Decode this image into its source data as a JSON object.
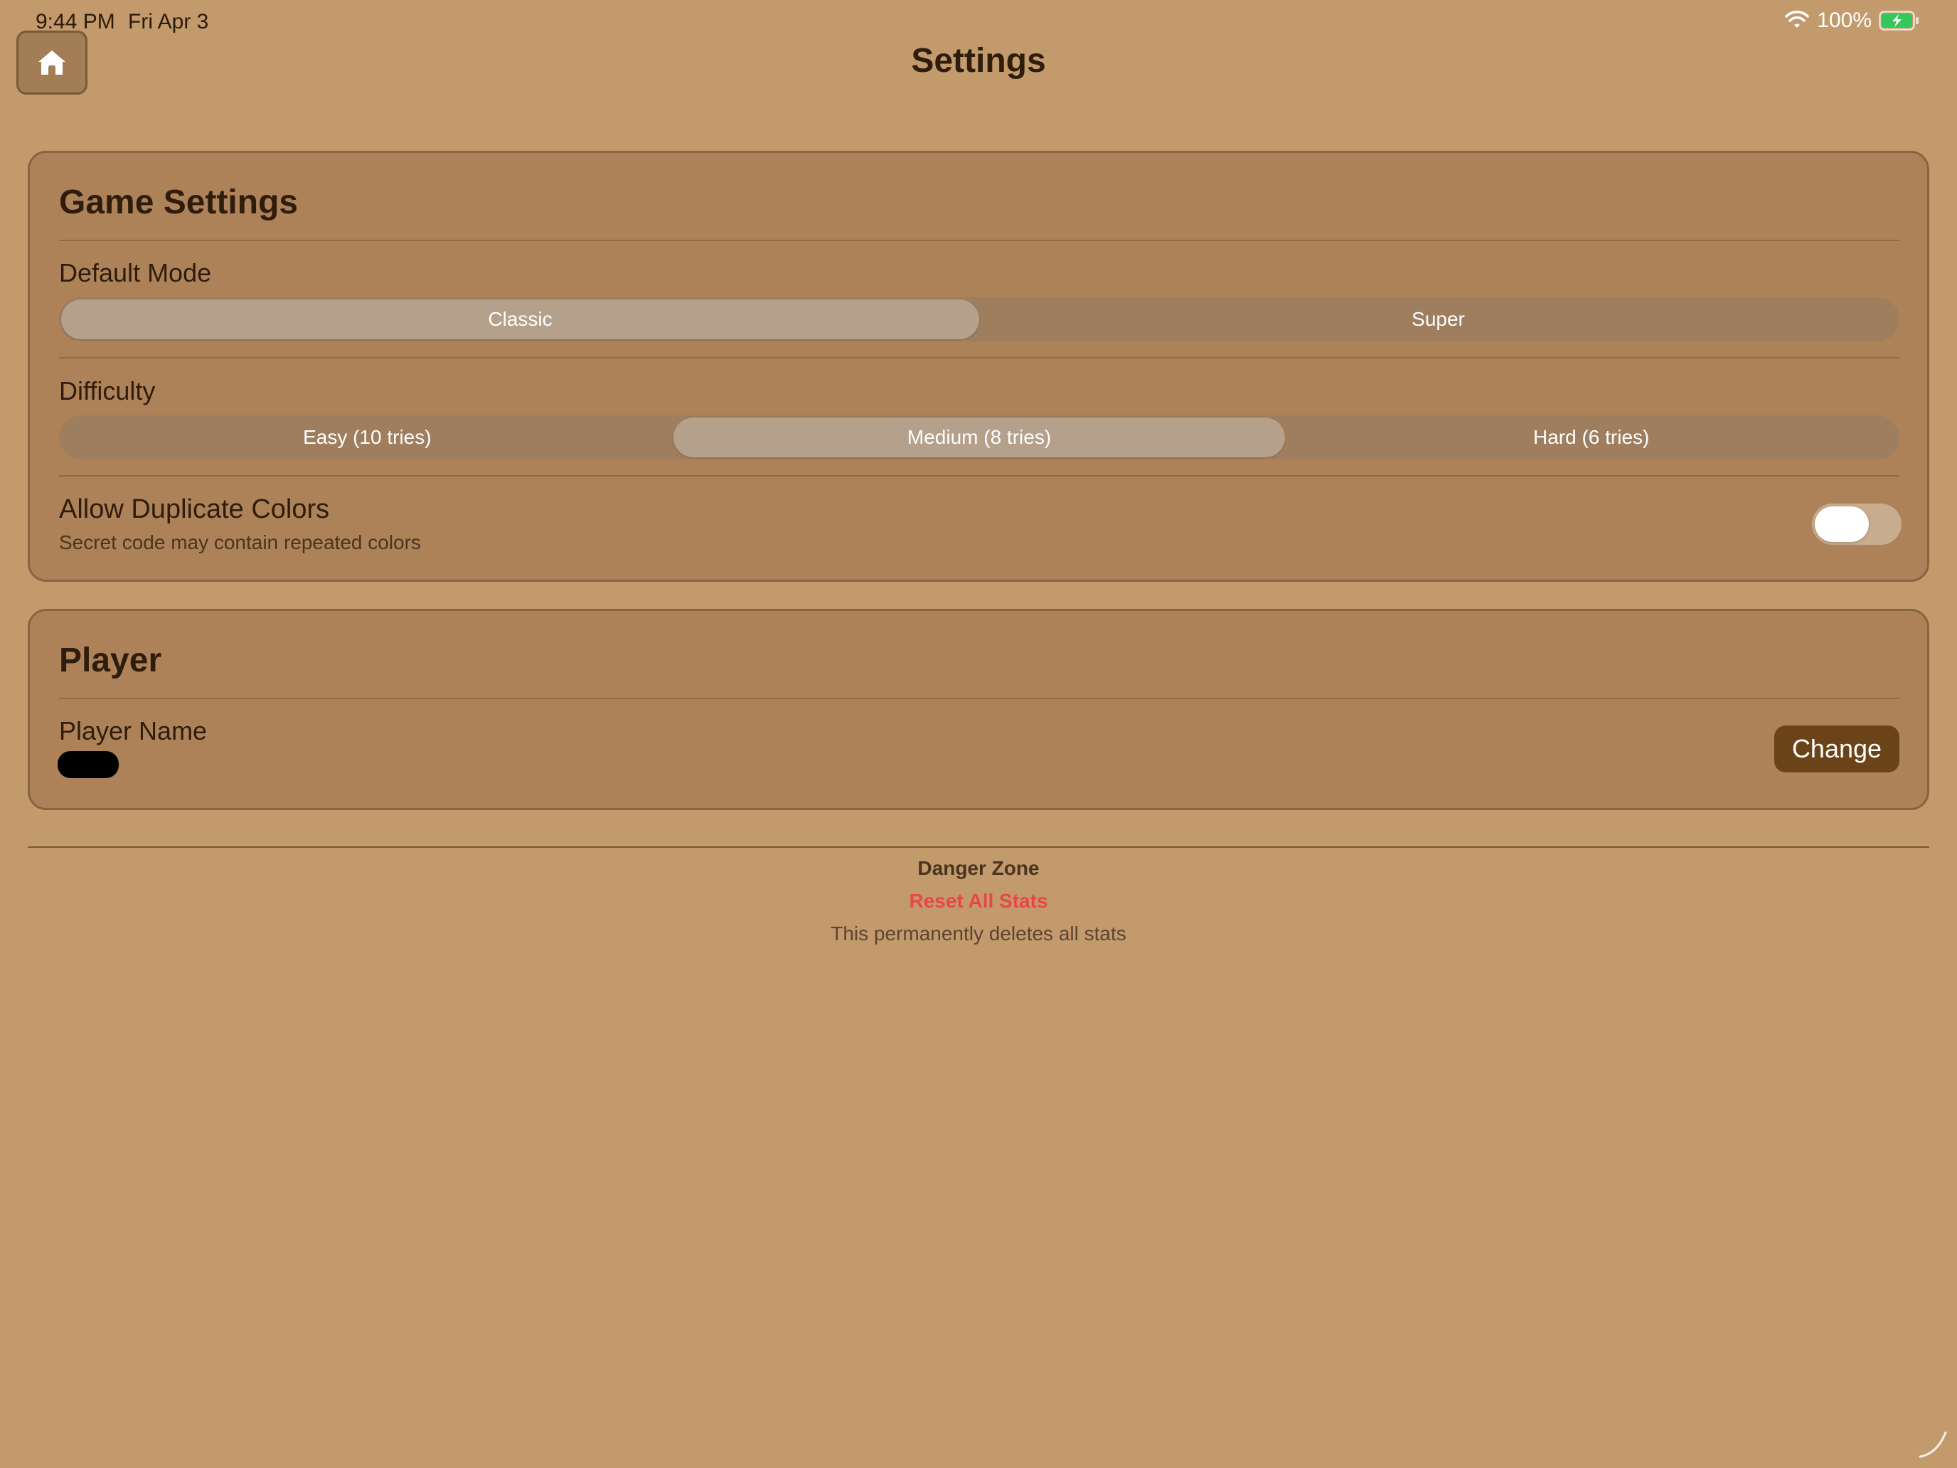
{
  "status_bar": {
    "time": "9:44 PM",
    "date": "Fri Apr 3",
    "battery": "100%",
    "icons": [
      "wifi-icon",
      "battery-charging-icon"
    ]
  },
  "header": {
    "title": "Settings",
    "home_icon": "home-icon"
  },
  "game_settings": {
    "title": "Game Settings",
    "default_mode": {
      "label": "Default Mode",
      "options": [
        "Classic",
        "Super"
      ],
      "selected": "Classic"
    },
    "difficulty": {
      "label": "Difficulty",
      "options": [
        "Easy (10 tries)",
        "Medium (8 tries)",
        "Hard (6 tries)"
      ],
      "selected": "Medium (8 tries)"
    },
    "allow_duplicates": {
      "title": "Allow Duplicate Colors",
      "subtitle": "Secret code may contain repeated colors",
      "enabled": false
    }
  },
  "player": {
    "title": "Player",
    "name_label": "Player Name",
    "change_label": "Change"
  },
  "danger_zone": {
    "title": "Danger Zone",
    "reset_label": "Reset All Stats",
    "note": "This permanently deletes all stats"
  },
  "colors": {
    "background": "#C29A6C",
    "card": "#AE8259",
    "accent": "#6A4418",
    "danger": "#E8474A"
  }
}
